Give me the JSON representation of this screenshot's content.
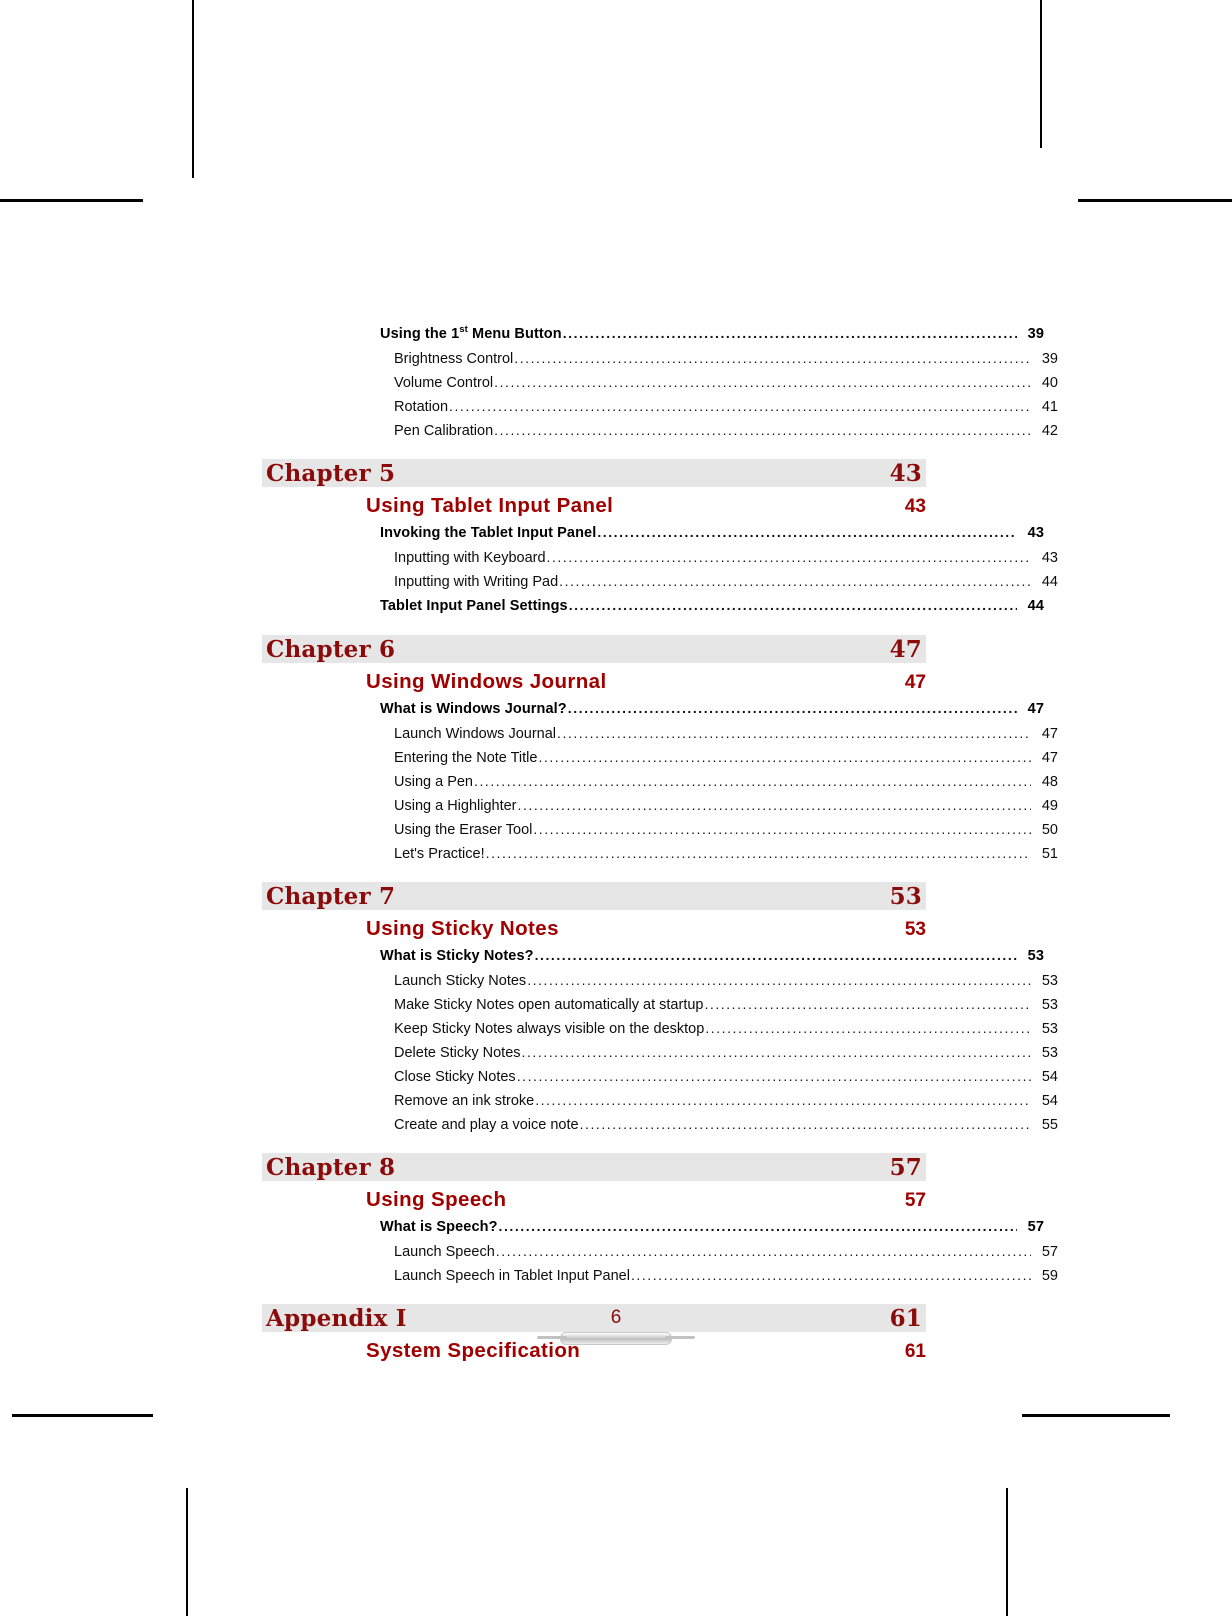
{
  "document": {
    "page_number": "6",
    "accent_color": "#8B0B0B",
    "section_color": "#A00000",
    "bar_color": "#e6e6e6"
  },
  "continued_entries": [
    {
      "level": 1,
      "label": "Using the 1st Menu Button",
      "label_pre": "Using the 1",
      "label_sup": "st",
      "label_post": " Menu Button",
      "page": "39"
    },
    {
      "level": 2,
      "label": "Brightness Control",
      "page": "39"
    },
    {
      "level": 2,
      "label": "Volume Control",
      "page": "40"
    },
    {
      "level": 2,
      "label": "Rotation",
      "page": "41"
    },
    {
      "level": 2,
      "label": "Pen Calibration",
      "page": "42"
    }
  ],
  "chapters": [
    {
      "bar_label": "Chapter 5",
      "bar_page": "43",
      "section_title": "Using Tablet Input Panel",
      "section_page": "43",
      "entries": [
        {
          "level": 1,
          "label": "Invoking the Tablet Input Panel",
          "page": "43"
        },
        {
          "level": 2,
          "label": "Inputting with Keyboard",
          "page": "43"
        },
        {
          "level": 2,
          "label": "Inputting with Writing Pad",
          "page": "44"
        },
        {
          "level": 1,
          "label": "Tablet Input Panel Settings",
          "page": "44"
        }
      ]
    },
    {
      "bar_label": "Chapter 6",
      "bar_page": "47",
      "section_title": "Using Windows Journal",
      "section_page": "47",
      "entries": [
        {
          "level": 1,
          "label": "What is Windows Journal?",
          "page": "47"
        },
        {
          "level": 2,
          "label": "Launch Windows Journal",
          "page": "47"
        },
        {
          "level": 2,
          "label": "Entering the Note Title",
          "page": "47"
        },
        {
          "level": 2,
          "label": "Using a Pen",
          "page": "48"
        },
        {
          "level": 2,
          "label": "Using a Highlighter",
          "page": "49"
        },
        {
          "level": 2,
          "label": "Using the Eraser Tool",
          "page": "50"
        },
        {
          "level": 2,
          "label": "Let's Practice!",
          "page": "51"
        }
      ]
    },
    {
      "bar_label": "Chapter 7",
      "bar_page": "53",
      "section_title": "Using Sticky Notes",
      "section_page": "53",
      "entries": [
        {
          "level": 1,
          "label": "What is Sticky Notes?",
          "page": "53"
        },
        {
          "level": 2,
          "label": "Launch Sticky Notes",
          "page": "53"
        },
        {
          "level": 2,
          "label": "Make Sticky Notes open automatically at startup",
          "page": "53"
        },
        {
          "level": 2,
          "label": "Keep Sticky Notes always visible on the desktop",
          "page": "53"
        },
        {
          "level": 2,
          "label": "Delete Sticky Notes",
          "page": "53"
        },
        {
          "level": 2,
          "label": "Close Sticky Notes",
          "page": "54"
        },
        {
          "level": 2,
          "label": "Remove an ink stroke",
          "page": "54"
        },
        {
          "level": 2,
          "label": "Create and play a voice note",
          "page": "55"
        }
      ]
    },
    {
      "bar_label": "Chapter 8",
      "bar_page": "57",
      "section_title": "Using Speech",
      "section_page": "57",
      "entries": [
        {
          "level": 1,
          "label": "What is Speech?",
          "page": "57"
        },
        {
          "level": 2,
          "label": "Launch Speech",
          "page": "57"
        },
        {
          "level": 2,
          "label": "Launch Speech in Tablet Input Panel",
          "page": "59"
        }
      ]
    },
    {
      "bar_label": "Appendix I",
      "bar_page": "61",
      "section_title": "System Specification",
      "section_page": "61",
      "entries": []
    }
  ],
  "dots": "...................................................................................................................................................."
}
